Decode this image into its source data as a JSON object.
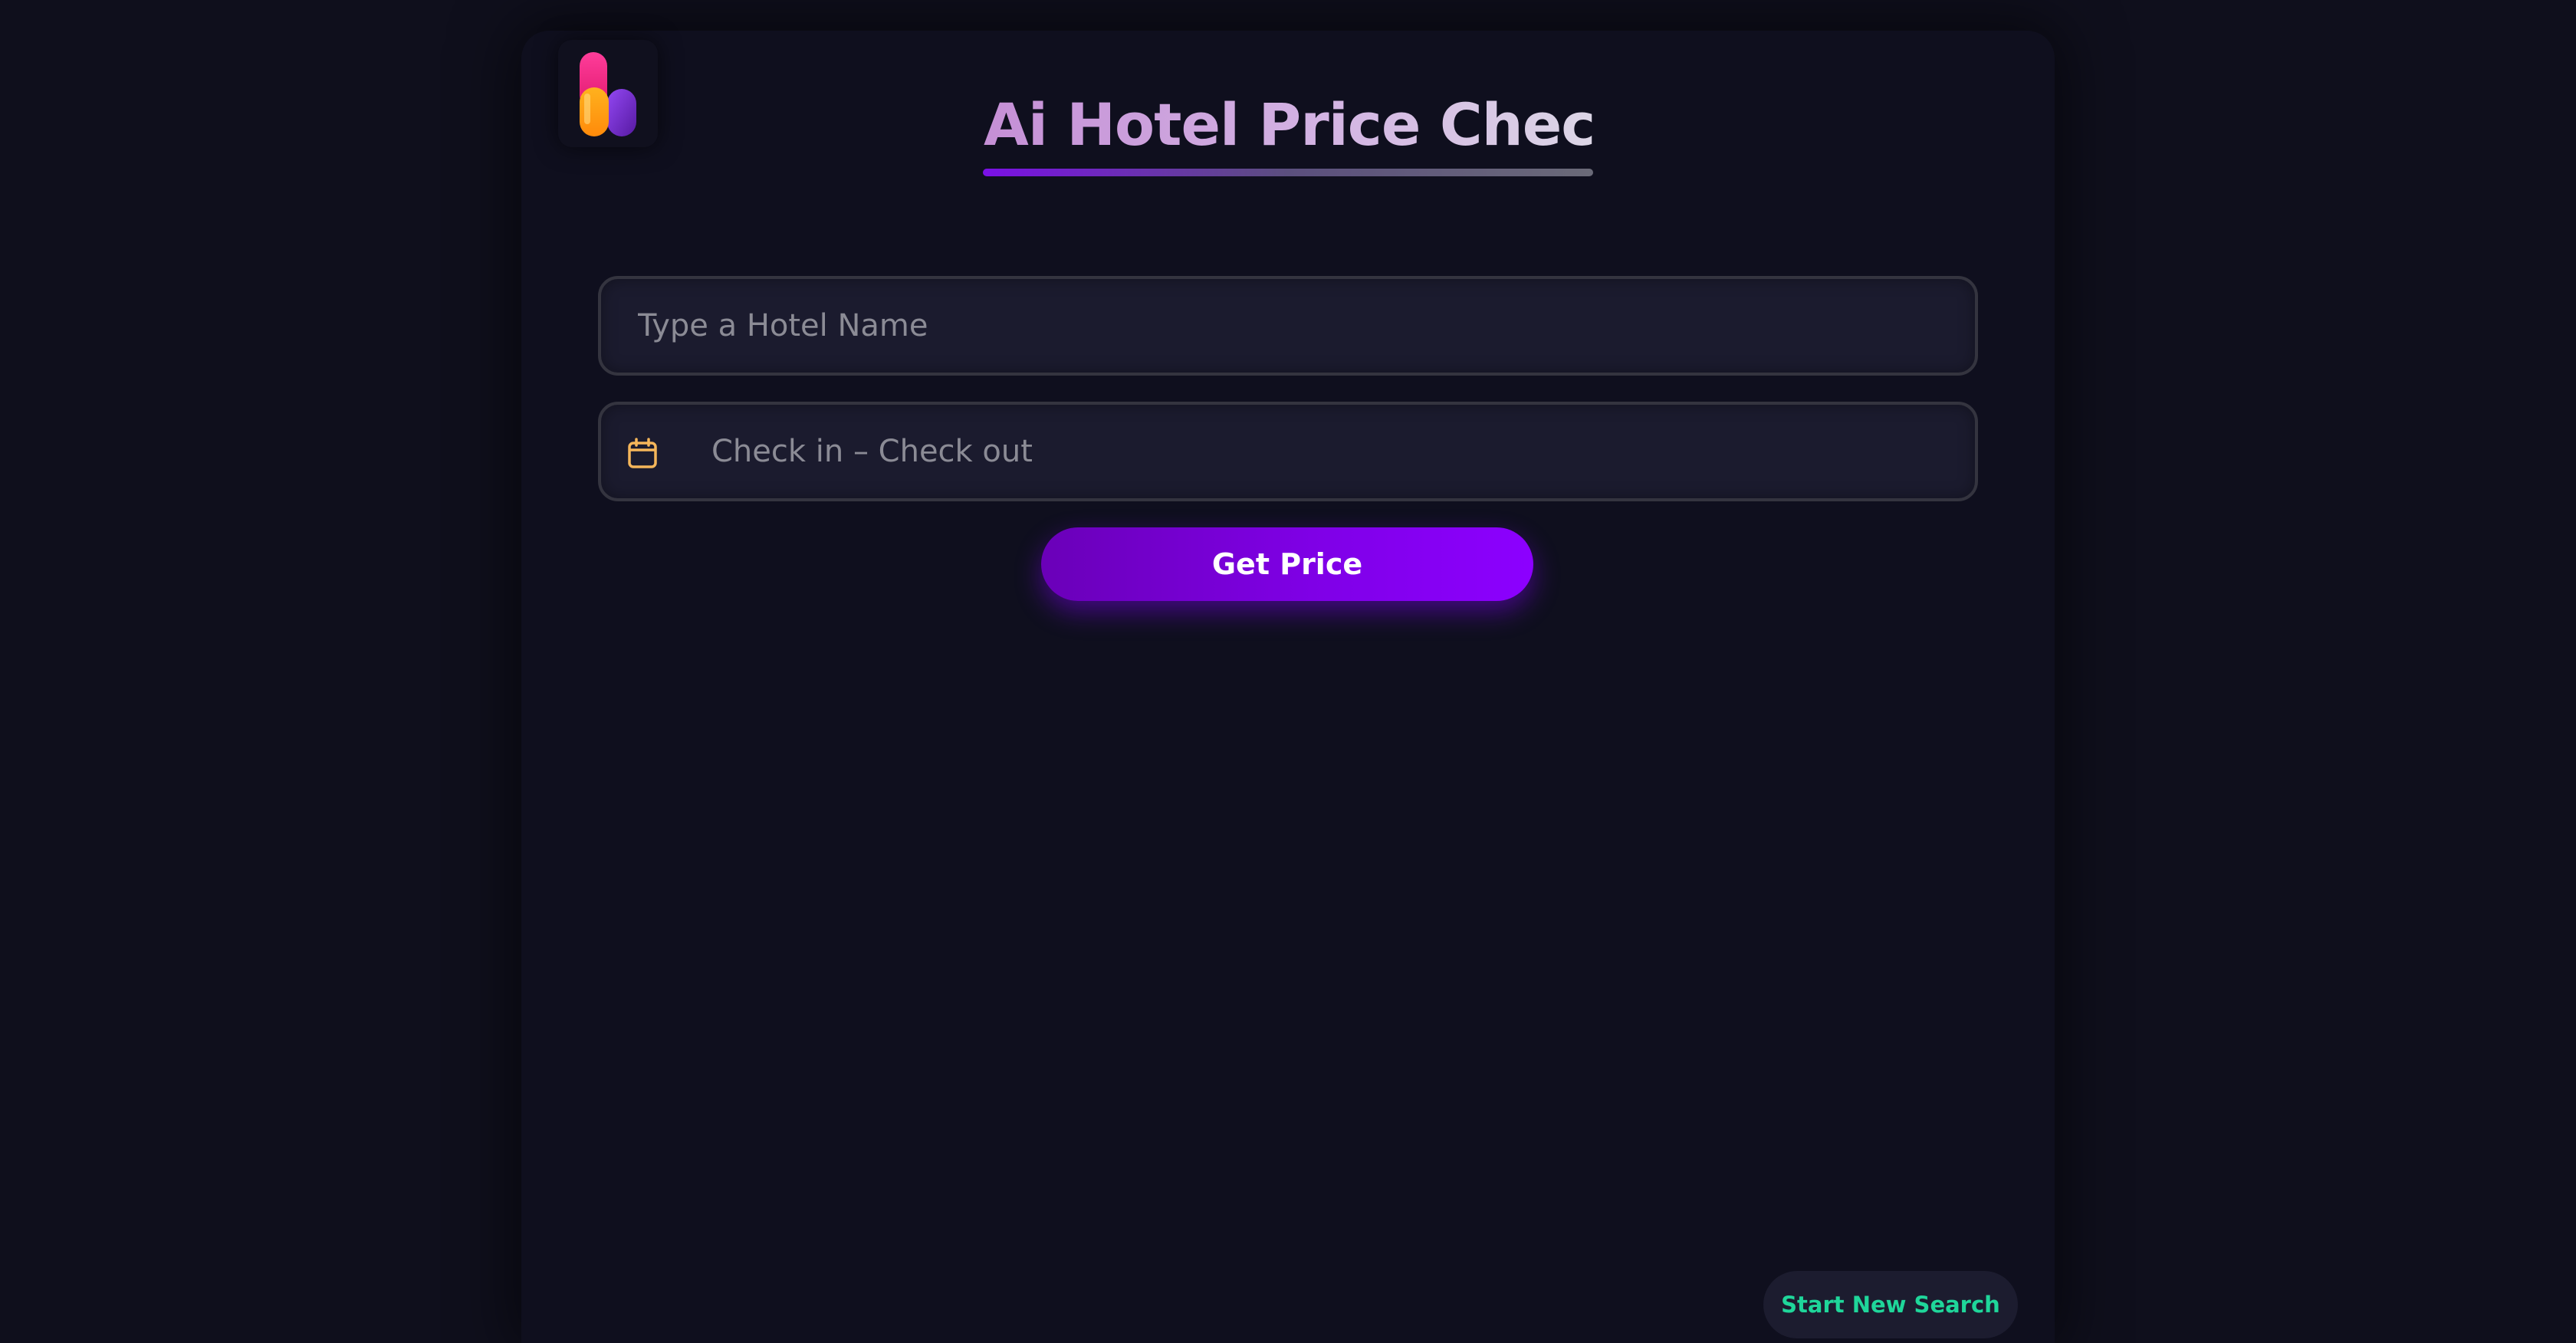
{
  "header": {
    "logo_icon": "hotel-brand-logo-icon",
    "title": "Ai Hotel Price Checker"
  },
  "form": {
    "hotel_name": {
      "value": "",
      "placeholder": "Type a Hotel Name"
    },
    "dates": {
      "icon": "calendar-icon",
      "value": "",
      "placeholder": "Check in – Check out"
    },
    "submit_label": "Get Price"
  },
  "footer": {
    "new_search_label": "Start New Search"
  },
  "colors": {
    "background": "#0f0f1c",
    "field_background": "#1b1b2e",
    "accent_purple": "#8c00ff",
    "new_search_text": "#1fd69a",
    "calendar_icon": "#f5b65a"
  }
}
